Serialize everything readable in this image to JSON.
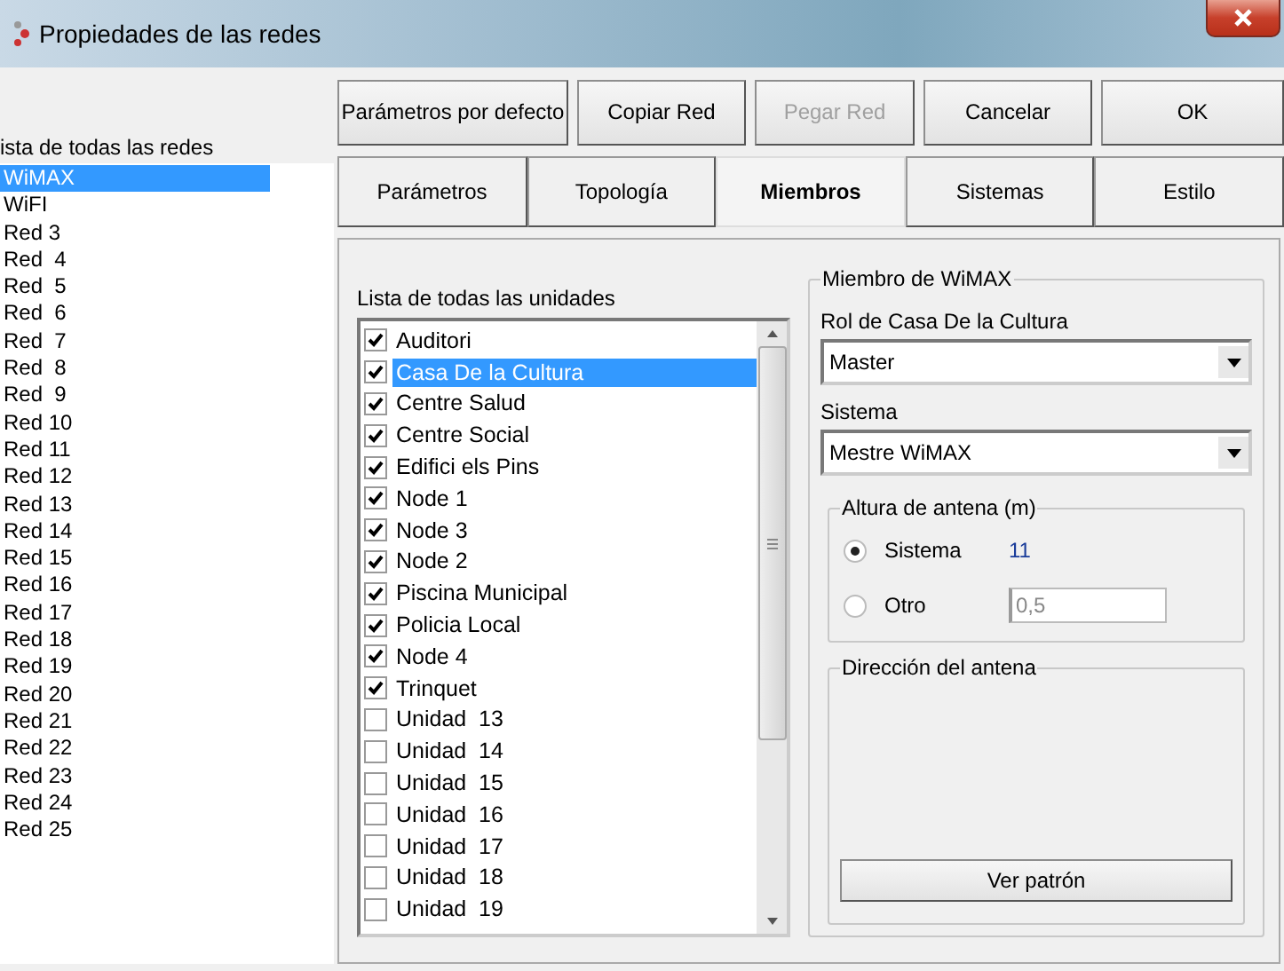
{
  "window": {
    "title": "Propiedades de las redes"
  },
  "networks": {
    "label": "ista de todas las redes",
    "items": [
      {
        "name": "WiMAX",
        "selected": true
      },
      {
        "name": "WiFI",
        "selected": false
      },
      {
        "name": "Red 3",
        "selected": false
      },
      {
        "name": "Red  4",
        "selected": false
      },
      {
        "name": "Red  5",
        "selected": false
      },
      {
        "name": "Red  6",
        "selected": false
      },
      {
        "name": "Red  7",
        "selected": false
      },
      {
        "name": "Red  8",
        "selected": false
      },
      {
        "name": "Red  9",
        "selected": false
      },
      {
        "name": "Red 10",
        "selected": false
      },
      {
        "name": "Red 11",
        "selected": false
      },
      {
        "name": "Red 12",
        "selected": false
      },
      {
        "name": "Red 13",
        "selected": false
      },
      {
        "name": "Red 14",
        "selected": false
      },
      {
        "name": "Red 15",
        "selected": false
      },
      {
        "name": "Red 16",
        "selected": false
      },
      {
        "name": "Red 17",
        "selected": false
      },
      {
        "name": "Red 18",
        "selected": false
      },
      {
        "name": "Red 19",
        "selected": false
      },
      {
        "name": "Red 20",
        "selected": false
      },
      {
        "name": "Red 21",
        "selected": false
      },
      {
        "name": "Red 22",
        "selected": false
      },
      {
        "name": "Red 23",
        "selected": false
      },
      {
        "name": "Red 24",
        "selected": false
      },
      {
        "name": "Red 25",
        "selected": false
      }
    ]
  },
  "buttons": [
    {
      "label": "Parámetros por defecto",
      "disabled": false
    },
    {
      "label": "Copiar Red",
      "disabled": false
    },
    {
      "label": "Pegar Red",
      "disabled": true
    },
    {
      "label": "Cancelar",
      "disabled": false
    },
    {
      "label": "OK",
      "disabled": false
    }
  ],
  "tabs": [
    {
      "label": "Parámetros",
      "selected": false
    },
    {
      "label": "Topología",
      "selected": false
    },
    {
      "label": "Miembros",
      "selected": true
    },
    {
      "label": "Sistemas",
      "selected": false
    },
    {
      "label": "Estilo",
      "selected": false
    }
  ],
  "units": {
    "label": "Lista de todas las unidades",
    "items": [
      {
        "name": "Auditori",
        "checked": true,
        "selected": false
      },
      {
        "name": "Casa De la Cultura",
        "checked": true,
        "selected": true
      },
      {
        "name": "Centre Salud",
        "checked": true,
        "selected": false
      },
      {
        "name": "Centre Social",
        "checked": true,
        "selected": false
      },
      {
        "name": "Edifici els Pins",
        "checked": true,
        "selected": false
      },
      {
        "name": "Node 1",
        "checked": true,
        "selected": false
      },
      {
        "name": "Node 3",
        "checked": true,
        "selected": false
      },
      {
        "name": "Node 2",
        "checked": true,
        "selected": false
      },
      {
        "name": "Piscina Municipal",
        "checked": true,
        "selected": false
      },
      {
        "name": "Policia Local",
        "checked": true,
        "selected": false
      },
      {
        "name": "Node 4",
        "checked": true,
        "selected": false
      },
      {
        "name": "Trinquet",
        "checked": true,
        "selected": false
      },
      {
        "name": "Unidad  13",
        "checked": false,
        "selected": false
      },
      {
        "name": "Unidad  14",
        "checked": false,
        "selected": false
      },
      {
        "name": "Unidad  15",
        "checked": false,
        "selected": false
      },
      {
        "name": "Unidad  16",
        "checked": false,
        "selected": false
      },
      {
        "name": "Unidad  17",
        "checked": false,
        "selected": false
      },
      {
        "name": "Unidad  18",
        "checked": false,
        "selected": false
      },
      {
        "name": "Unidad  19",
        "checked": false,
        "selected": false
      }
    ]
  },
  "member": {
    "title": "Miembro de WiMAX",
    "role_label": "Rol de Casa De la Cultura",
    "role_value": "Master",
    "system_label": "Sistema",
    "system_value": "Mestre WiMAX",
    "height": {
      "title": "Altura de antena (m)",
      "options": [
        {
          "label": "Sistema",
          "selected": true,
          "value": "11",
          "kind": "text"
        },
        {
          "label": "Otro",
          "selected": false,
          "value": "0,5",
          "kind": "field"
        }
      ]
    },
    "direction": {
      "title": "Dirección del antena",
      "button": "Ver patrón"
    }
  }
}
